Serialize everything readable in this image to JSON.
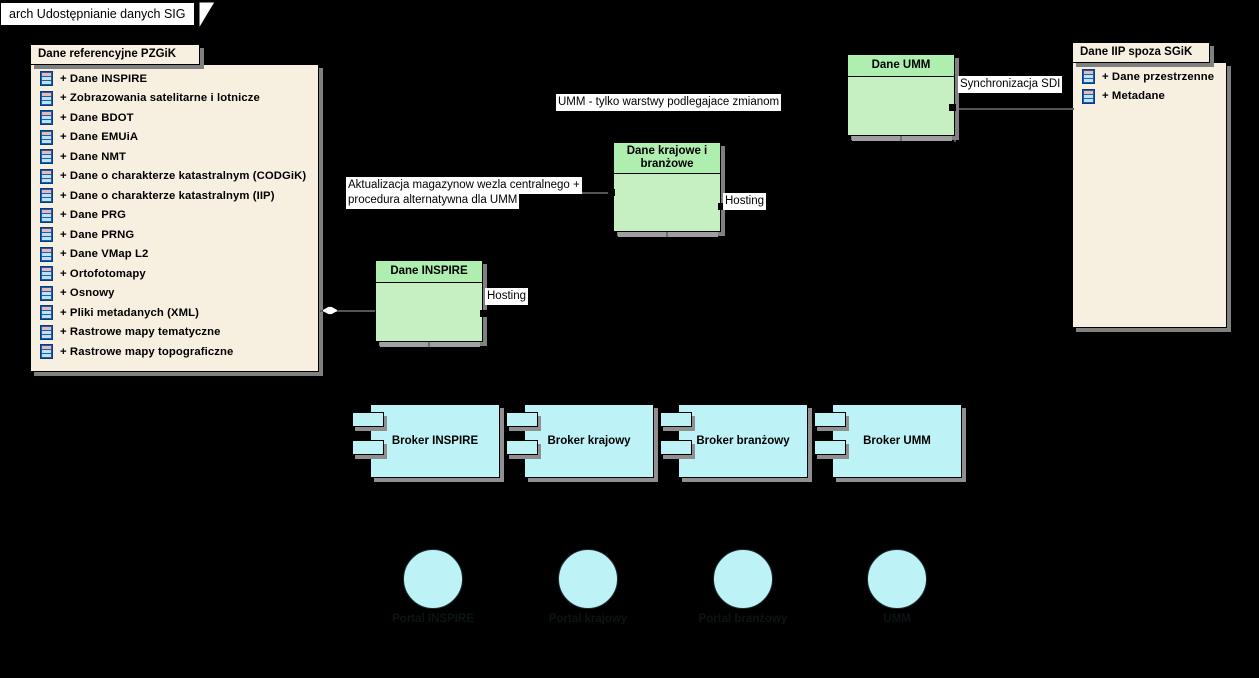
{
  "diagram": {
    "frame_title": "arch Udostępnianie danych SIG",
    "background_color": "#000000"
  },
  "packages": [
    {
      "title": "Dane referencyjne PZGiK",
      "items": [
        "+ Dane INSPIRE",
        "+ Zobrazowania satelitarne i lotnicze",
        "+ Dane BDOT",
        "+ Dane EMUiA",
        "+ Dane NMT",
        "+ Dane o charakterze katastralnym (CODGiK)",
        "+ Dane o charakterze katastralnym (IIP)",
        "+ Dane PRG",
        "+ Dane PRNG",
        "+ Dane VMap L2",
        "+ Ortofotomapy",
        "+ Osnowy",
        "+ Pliki metadanych (XML)",
        "+ Rastrowe mapy tematyczne",
        "+ Rastrowe mapy topograficzne"
      ]
    },
    {
      "title": "Dane IIP spoza SGiK",
      "items": [
        "+ Dane przestrzenne",
        "+ Metadane"
      ]
    }
  ],
  "components": [
    {
      "title": "Dane UMM"
    },
    {
      "title": "Dane krajowe i branżowe"
    },
    {
      "title": "Dane INSPIRE"
    }
  ],
  "brokers": [
    {
      "label": "Broker INSPIRE"
    },
    {
      "label": "Broker krajowy"
    },
    {
      "label": "Broker branżowy"
    },
    {
      "label": "Broker UMM"
    }
  ],
  "interfaces": [
    {
      "label": "Portal INSPIRE"
    },
    {
      "label": "Portal krajowy"
    },
    {
      "label": "Portal branżowy"
    },
    {
      "label": "UMM"
    }
  ],
  "edge_labels": {
    "umm_note": "UMM - tylko warstwy podlegajace zmianom",
    "sync_sdi": "Synchronizacja SDI",
    "aktualizacja_line1": "Aktualizacja magazynow wezla centralnego +",
    "aktualizacja_line2": "procedura alternatywna dla UMM",
    "hosting_krajowe": "Hosting",
    "hosting_inspire": "Hosting"
  },
  "colors": {
    "package_fill": "#f7efe0",
    "component_head_fill": "#aeeeae",
    "component_body_fill": "#c6f0c2",
    "broker_fill": "#bdf3f7",
    "interface_fill": "#bdf3f7",
    "shadow": "#808080",
    "line": "#555555",
    "label_bg": "#ffffff",
    "text": "#000000"
  }
}
